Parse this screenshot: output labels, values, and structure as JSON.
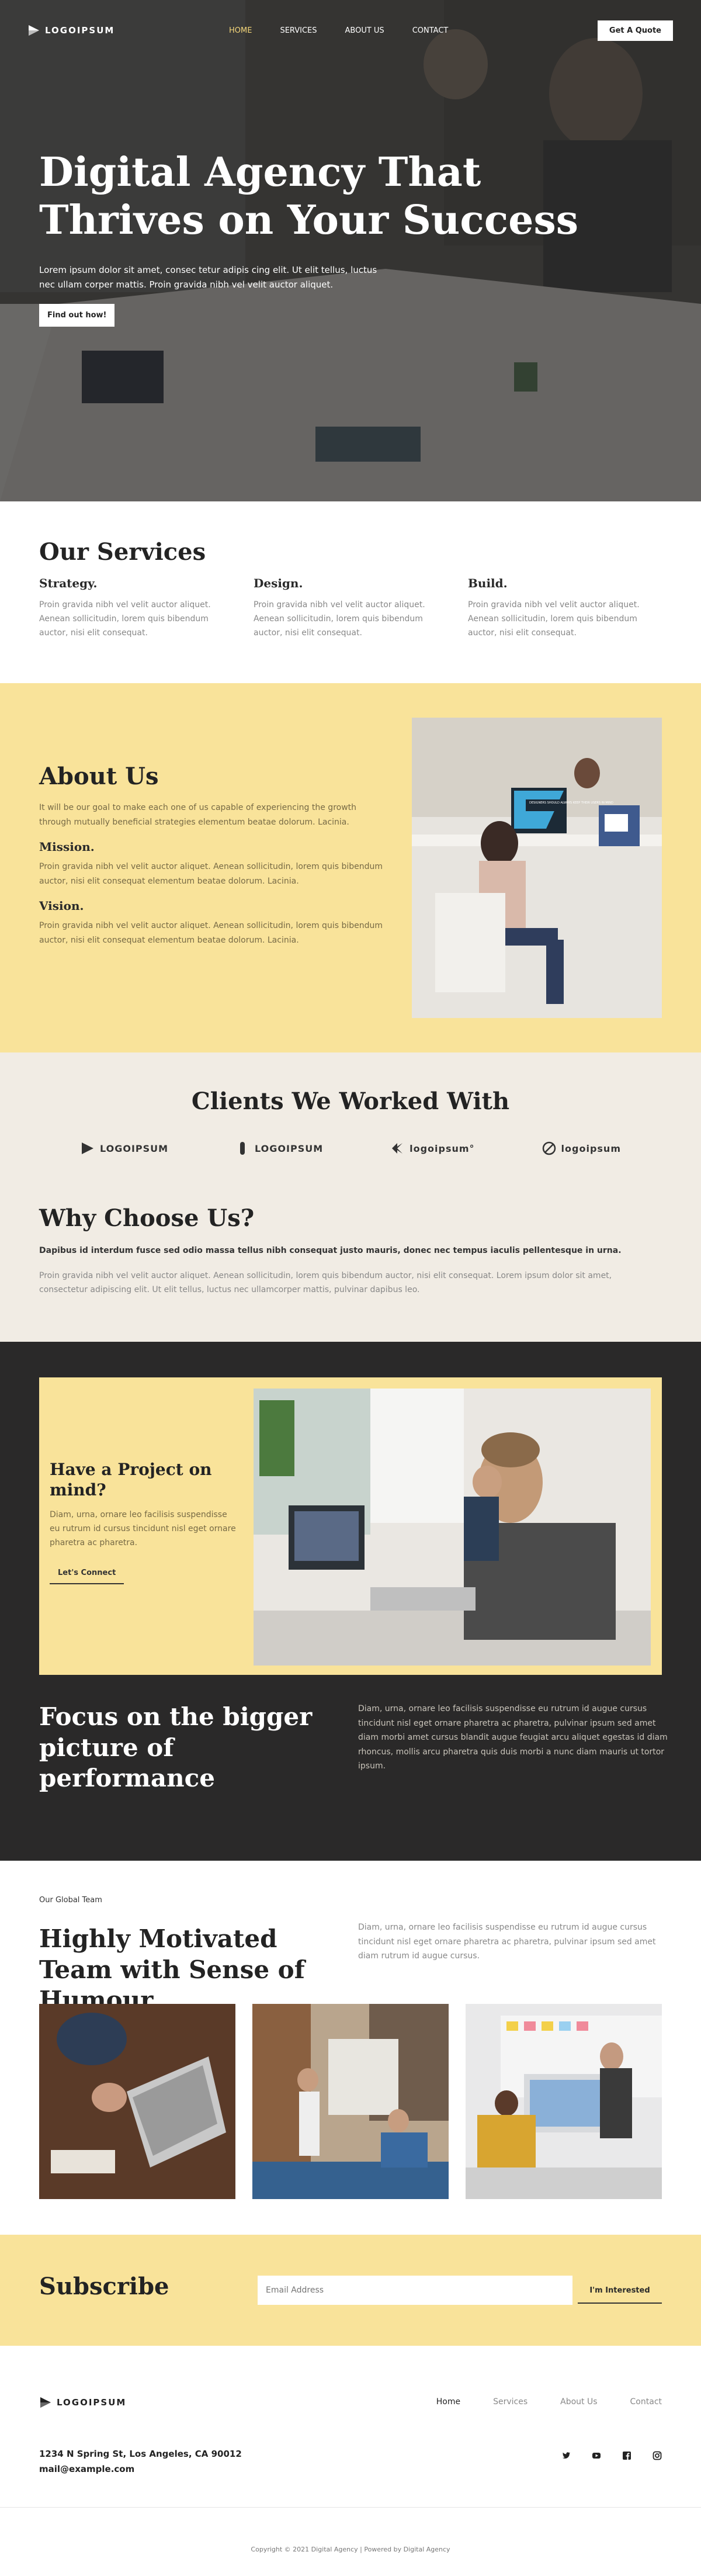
{
  "nav": {
    "logo_text": "LOGOIPSUM",
    "menu": [
      {
        "label": "HOME",
        "active": true
      },
      {
        "label": "SERVICES",
        "active": false
      },
      {
        "label": "ABOUT US",
        "active": false
      },
      {
        "label": "CONTACT",
        "active": false
      }
    ],
    "cta": "Get A Quote"
  },
  "hero": {
    "title_line1": "Digital Agency That",
    "title_line2": "Thrives on Your Success",
    "text": "Lorem ipsum dolor sit amet, consec tetur adipis cing elit. Ut elit tellus, luctus nec ullam corper mattis. Proin gravida nibh vel velit auctor aliquet.",
    "button": "Find out how!"
  },
  "services": {
    "title": "Our Services",
    "items": [
      {
        "title": "Strategy.",
        "text": "Proin gravida nibh vel velit auctor aliquet. Aenean sollicitudin, lorem quis bibendum auctor, nisi elit consequat."
      },
      {
        "title": "Design.",
        "text": "Proin gravida nibh vel velit auctor aliquet. Aenean sollicitudin, lorem quis bibendum auctor, nisi elit consequat."
      },
      {
        "title": "Build.",
        "text": "Proin gravida nibh vel velit auctor aliquet. Aenean sollicitudin, lorem quis bibendum auctor, nisi elit consequat."
      }
    ]
  },
  "about": {
    "title": "About Us",
    "intro": "It will be our goal to make each one of us capable of experiencing the growth through mutually beneficial strategies elementum beatae dolorum. Lacinia.",
    "mission_title": "Mission.",
    "mission_text": "Proin gravida nibh vel velit auctor aliquet. Aenean sollicitudin, lorem quis bibendum auctor, nisi elit consequat elementum beatae dolorum. Lacinia.",
    "vision_title": "Vision.",
    "vision_text": "Proin gravida nibh vel velit auctor aliquet. Aenean sollicitudin, lorem quis bibendum auctor, nisi elit consequat elementum beatae dolorum. Lacinia.",
    "screen_text": "DESIGNERS SHOULD ALWAYS KEEP THEIR USERS IN MIND"
  },
  "clients": {
    "title": "Clients We Worked With",
    "logos": [
      "LOGOIPSUM",
      "LOGOIPSUM",
      "logoipsum°",
      "logoipsum"
    ]
  },
  "why": {
    "title": "Why Choose Us?",
    "lead": "Dapibus id interdum fusce sed odio massa tellus nibh consequat justo mauris, donec nec tempus iaculis pellentesque in urna.",
    "body": "Proin gravida nibh vel velit auctor aliquet. Aenean sollicitudin, lorem quis bibendum auctor, nisi elit consequat. Lorem ipsum dolor sit amet, consectetur adipiscing elit. Ut elit tellus, luctus nec ullamcorper mattis, pulvinar dapibus leo."
  },
  "project": {
    "title": "Have a Project on mind?",
    "text": "Diam, urna, ornare leo facilisis suspendisse eu rutrum id cursus tincidunt nisl eget ornare pharetra ac pharetra.",
    "button": "Let's Connect"
  },
  "focus": {
    "title": "Focus on the bigger picture of performance",
    "text": "Diam, urna, ornare leo facilisis suspendisse eu rutrum id augue cursus tincidunt nisl eget ornare pharetra ac pharetra, pulvinar ipsum sed amet diam morbi amet cursus blandit augue feugiat arcu aliquet egestas id diam rhoncus, mollis arcu pharetra quis duis morbi a nunc diam mauris ut tortor ipsum."
  },
  "team": {
    "eyebrow": "Our Global Team",
    "title": "Highly Motivated Team with Sense of Humour",
    "text": "Diam, urna, ornare leo facilisis suspendisse eu rutrum id augue cursus tincidunt nisl eget ornare pharetra ac pharetra, pulvinar ipsum sed amet diam rutrum id augue cursus."
  },
  "subscribe": {
    "title": "Subscribe",
    "placeholder": "Email Address",
    "button": "I'm Interested"
  },
  "footer": {
    "logo_text": "LOGOIPSUM",
    "menu": [
      {
        "label": "Home",
        "active": true
      },
      {
        "label": "Services",
        "active": false
      },
      {
        "label": "About Us",
        "active": false
      },
      {
        "label": "Contact",
        "active": false
      }
    ],
    "address_line1": "1234 N Spring St, Los Angeles, CA 90012",
    "address_line2": "mail@example.com",
    "socials": [
      "twitter-icon",
      "youtube-icon",
      "facebook-icon",
      "instagram-icon"
    ],
    "copyright": "Copyright © 2021 Digital Agency | Powered by Digital Agency"
  },
  "colors": {
    "accent_yellow": "#f9e39a",
    "dark": "#2a2929",
    "beige": "#f1ece4",
    "nav_active": "#f5d77a"
  }
}
